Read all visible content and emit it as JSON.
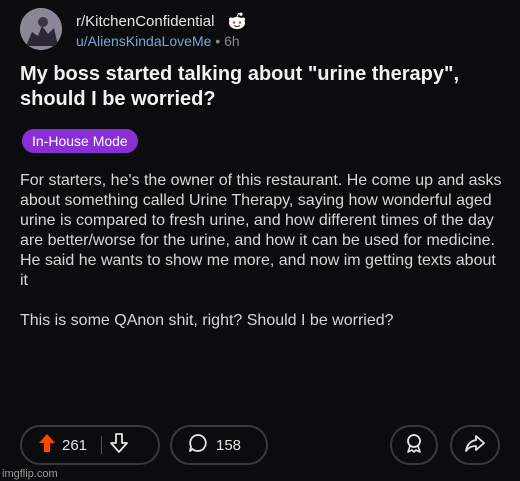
{
  "post": {
    "subreddit": "r/KitchenConfidential",
    "username": "u/AliensKindaLoveMe",
    "separator": "•",
    "age": "6h",
    "title": "My boss started talking about \"urine therapy\", should I be worried?",
    "flair": "In-House Mode",
    "body_paragraphs": [
      "For starters, he's the owner of this restaurant. He come up and asks about something called Urine Therapy, saying how wonderful aged urine is compared to fresh urine, and how different times of the day are better/worse for the urine, and how it can be used for medicine. He said he wants to show me more, and now im getting texts about it",
      "This is some QAnon shit, right? Should I be worried?"
    ]
  },
  "actions": {
    "upvotes": "261",
    "comments": "158"
  },
  "icons": {
    "upvote": "upvote-arrow-icon",
    "downvote": "downvote-arrow-icon",
    "comment": "comment-bubble-icon",
    "save": "award-ribbon-icon",
    "share": "share-arrow-icon",
    "logo": "reddit-logo-icon"
  },
  "colors": {
    "background": "#0c0c0e",
    "upvote_orange": "#ff4500",
    "flair_purple": "#8a2fd6",
    "username_blue": "#7aa3d8"
  },
  "watermark": "imgflip.com"
}
